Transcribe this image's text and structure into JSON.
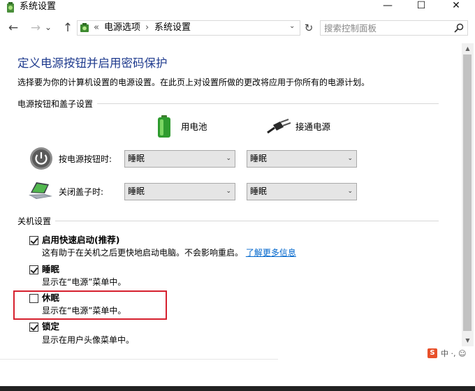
{
  "window": {
    "title": "系统设置",
    "controls": {
      "minimize": "—",
      "maximize": "☐",
      "close": "✕"
    }
  },
  "address_bar": {
    "back_glyph": "←",
    "forward_glyph": "→",
    "history_glyph": "⌄",
    "up_glyph": "↑",
    "overflow": "«",
    "crumbs": [
      "电源选项",
      "系统设置"
    ],
    "separator": "›",
    "dropdown_glyph": "⌄",
    "refresh_glyph": "↻",
    "search_placeholder": "搜索控制面板"
  },
  "page": {
    "title": "定义电源按钮并启用密码保护",
    "description": "选择要为你的计算机设置的电源设置。在此页上对设置所做的更改将应用于你所有的电源计划。"
  },
  "power_section": {
    "label": "电源按钮和盖子设置",
    "columns": {
      "battery": "用电池",
      "plugged": "接通电源"
    },
    "rows": [
      {
        "label": "按电源按钮时:",
        "battery_value": "睡眠",
        "plugged_value": "睡眠"
      },
      {
        "label": "关闭盖子时:",
        "battery_value": "睡眠",
        "plugged_value": "睡眠"
      }
    ],
    "chevron": "⌄"
  },
  "shutdown_section": {
    "label": "关机设置",
    "options": [
      {
        "title": "启用快速启动(推荐)",
        "desc": "这有助于在关机之后更快地启动电脑。不会影响重启。",
        "link": "了解更多信息",
        "checked": true
      },
      {
        "title": "睡眠",
        "desc": "显示在“电源”菜单中。",
        "checked": true
      },
      {
        "title": "休眠",
        "desc": "显示在“电源”菜单中。",
        "checked": false
      },
      {
        "title": "锁定",
        "desc": "显示在用户头像菜单中。",
        "checked": true
      }
    ]
  },
  "scrollbar": {
    "up": "▲",
    "down": "▼"
  },
  "ime": {
    "logo": "S",
    "text": "中 ·, ☺"
  },
  "colors": {
    "title_blue": "#1f3b8e",
    "link_blue": "#0066cc",
    "highlight_red": "#d6202e"
  }
}
